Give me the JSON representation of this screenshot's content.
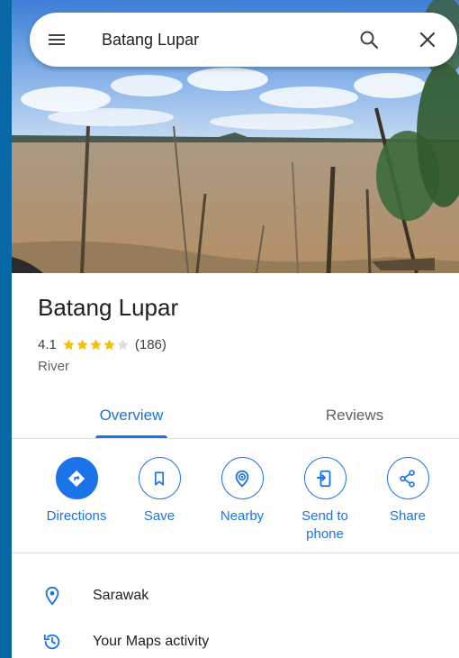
{
  "search": {
    "query": "Batang Lupar"
  },
  "place": {
    "name": "Batang Lupar",
    "rating": "4.1",
    "stars_filled": 4,
    "reviews_count": "(186)",
    "category": "River"
  },
  "tabs": [
    {
      "label": "Overview",
      "active": true
    },
    {
      "label": "Reviews",
      "active": false
    }
  ],
  "actions": [
    {
      "label": "Directions",
      "icon": "directions-icon"
    },
    {
      "label": "Save",
      "icon": "bookmark-icon"
    },
    {
      "label": "Nearby",
      "icon": "nearby-icon"
    },
    {
      "label": "Send to phone",
      "icon": "send-to-phone-icon"
    },
    {
      "label": "Share",
      "icon": "share-icon"
    }
  ],
  "list": [
    {
      "text": "Sarawak",
      "icon": "location-pin-icon"
    },
    {
      "text": "Your Maps activity",
      "icon": "history-icon"
    }
  ],
  "colors": {
    "accent": "#1a73e8",
    "star": "#fbbc04",
    "frame": "#0867a5"
  }
}
